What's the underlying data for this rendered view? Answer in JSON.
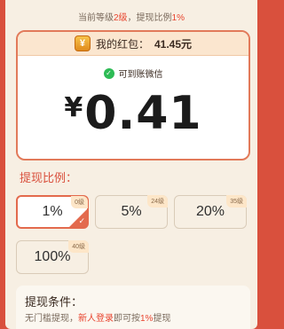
{
  "header": {
    "level_prefix": "当前等级",
    "level_value": "2级",
    "level_mid": "，提现比例",
    "ratio_value": "1%"
  },
  "redpacket": {
    "label": "我的红包：",
    "amount": "41.45元",
    "icon": "yen-coin-icon",
    "wechat_label": "可到账微信",
    "currency_symbol": "¥",
    "withdraw_amount": "0.41"
  },
  "ratio": {
    "title": "提现比例："
  },
  "options": [
    {
      "label": "1%",
      "tag": "0级",
      "selected": true
    },
    {
      "label": "5%",
      "tag": "24级",
      "selected": false
    },
    {
      "label": "20%",
      "tag": "35级",
      "selected": false
    },
    {
      "label": "100%",
      "tag": "40级",
      "selected": false
    }
  ],
  "conditions": {
    "title": "提现条件：",
    "text_a": "无门槛提现，",
    "text_b": "新人登录",
    "text_c": "即可按",
    "text_d": "1%",
    "text_e": "提现"
  },
  "colors": {
    "accent": "#d9503d",
    "highlight": "#e8452f",
    "selected_border": "#e36a4d",
    "success": "#2dbb55"
  }
}
